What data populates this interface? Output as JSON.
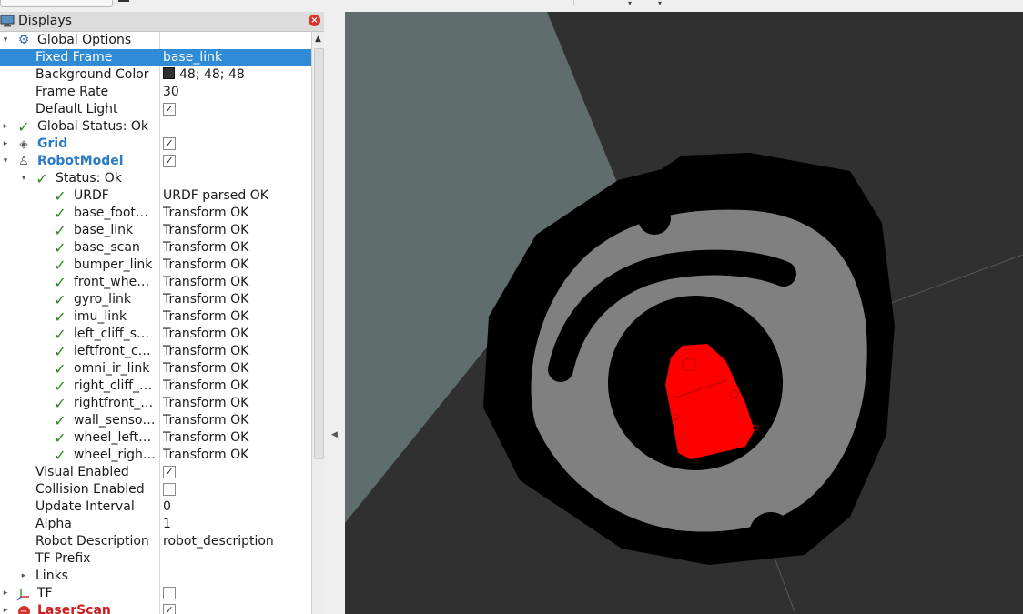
{
  "panel": {
    "title": "Displays",
    "icon": "monitor-icon",
    "close_icon": "close-icon"
  },
  "tree": {
    "global_options": {
      "label": "Global Options"
    },
    "fixed_frame": {
      "label": "Fixed Frame",
      "value": "base_link"
    },
    "background_color": {
      "label": "Background Color",
      "value": "48; 48; 48",
      "color": "#303030"
    },
    "frame_rate": {
      "label": "Frame Rate",
      "value": "30"
    },
    "default_light": {
      "label": "Default Light",
      "checked": true
    },
    "global_status": {
      "label": "Global Status: Ok"
    },
    "grid": {
      "label": "Grid",
      "checked": true
    },
    "robot_model": {
      "label": "RobotModel",
      "checked": true
    },
    "status": {
      "label": "Status: Ok"
    },
    "links": [
      {
        "name": "URDF",
        "value": "URDF parsed OK"
      },
      {
        "name": "base_foot…",
        "value": "Transform OK"
      },
      {
        "name": "base_link",
        "value": "Transform OK"
      },
      {
        "name": "base_scan",
        "value": "Transform OK"
      },
      {
        "name": "bumper_link",
        "value": "Transform OK"
      },
      {
        "name": "front_whe…",
        "value": "Transform OK"
      },
      {
        "name": "gyro_link",
        "value": "Transform OK"
      },
      {
        "name": "imu_link",
        "value": "Transform OK"
      },
      {
        "name": "left_cliff_s…",
        "value": "Transform OK"
      },
      {
        "name": "leftfront_c…",
        "value": "Transform OK"
      },
      {
        "name": "omni_ir_link",
        "value": "Transform OK"
      },
      {
        "name": "right_cliff_…",
        "value": "Transform OK"
      },
      {
        "name": "rightfront_…",
        "value": "Transform OK"
      },
      {
        "name": "wall_senso…",
        "value": "Transform OK"
      },
      {
        "name": "wheel_left…",
        "value": "Transform OK"
      },
      {
        "name": "wheel_righ…",
        "value": "Transform OK"
      }
    ],
    "visual_enabled": {
      "label": "Visual Enabled",
      "checked": true
    },
    "collision_enabled": {
      "label": "Collision Enabled",
      "checked": false
    },
    "update_interval": {
      "label": "Update Interval",
      "value": "0"
    },
    "alpha": {
      "label": "Alpha",
      "value": "1"
    },
    "robot_description": {
      "label": "Robot Description",
      "value": "robot_description"
    },
    "tf_prefix": {
      "label": "TF Prefix"
    },
    "links_group": {
      "label": "Links"
    },
    "tf": {
      "label": "TF",
      "checked": false
    },
    "laserscan": {
      "label": "LaserScan",
      "checked": true
    }
  },
  "viewport": {
    "background": "#303030",
    "map_gray": "#808080",
    "map_black": "#000000",
    "plane_color": "#5f6e6c",
    "robot_color": "#ff0000"
  },
  "colors": {
    "selection": "#2f8bd6",
    "ok_check": "#2c8a1d",
    "display_blue": "#2a7bc6",
    "error_red": "#cc1e1e"
  }
}
